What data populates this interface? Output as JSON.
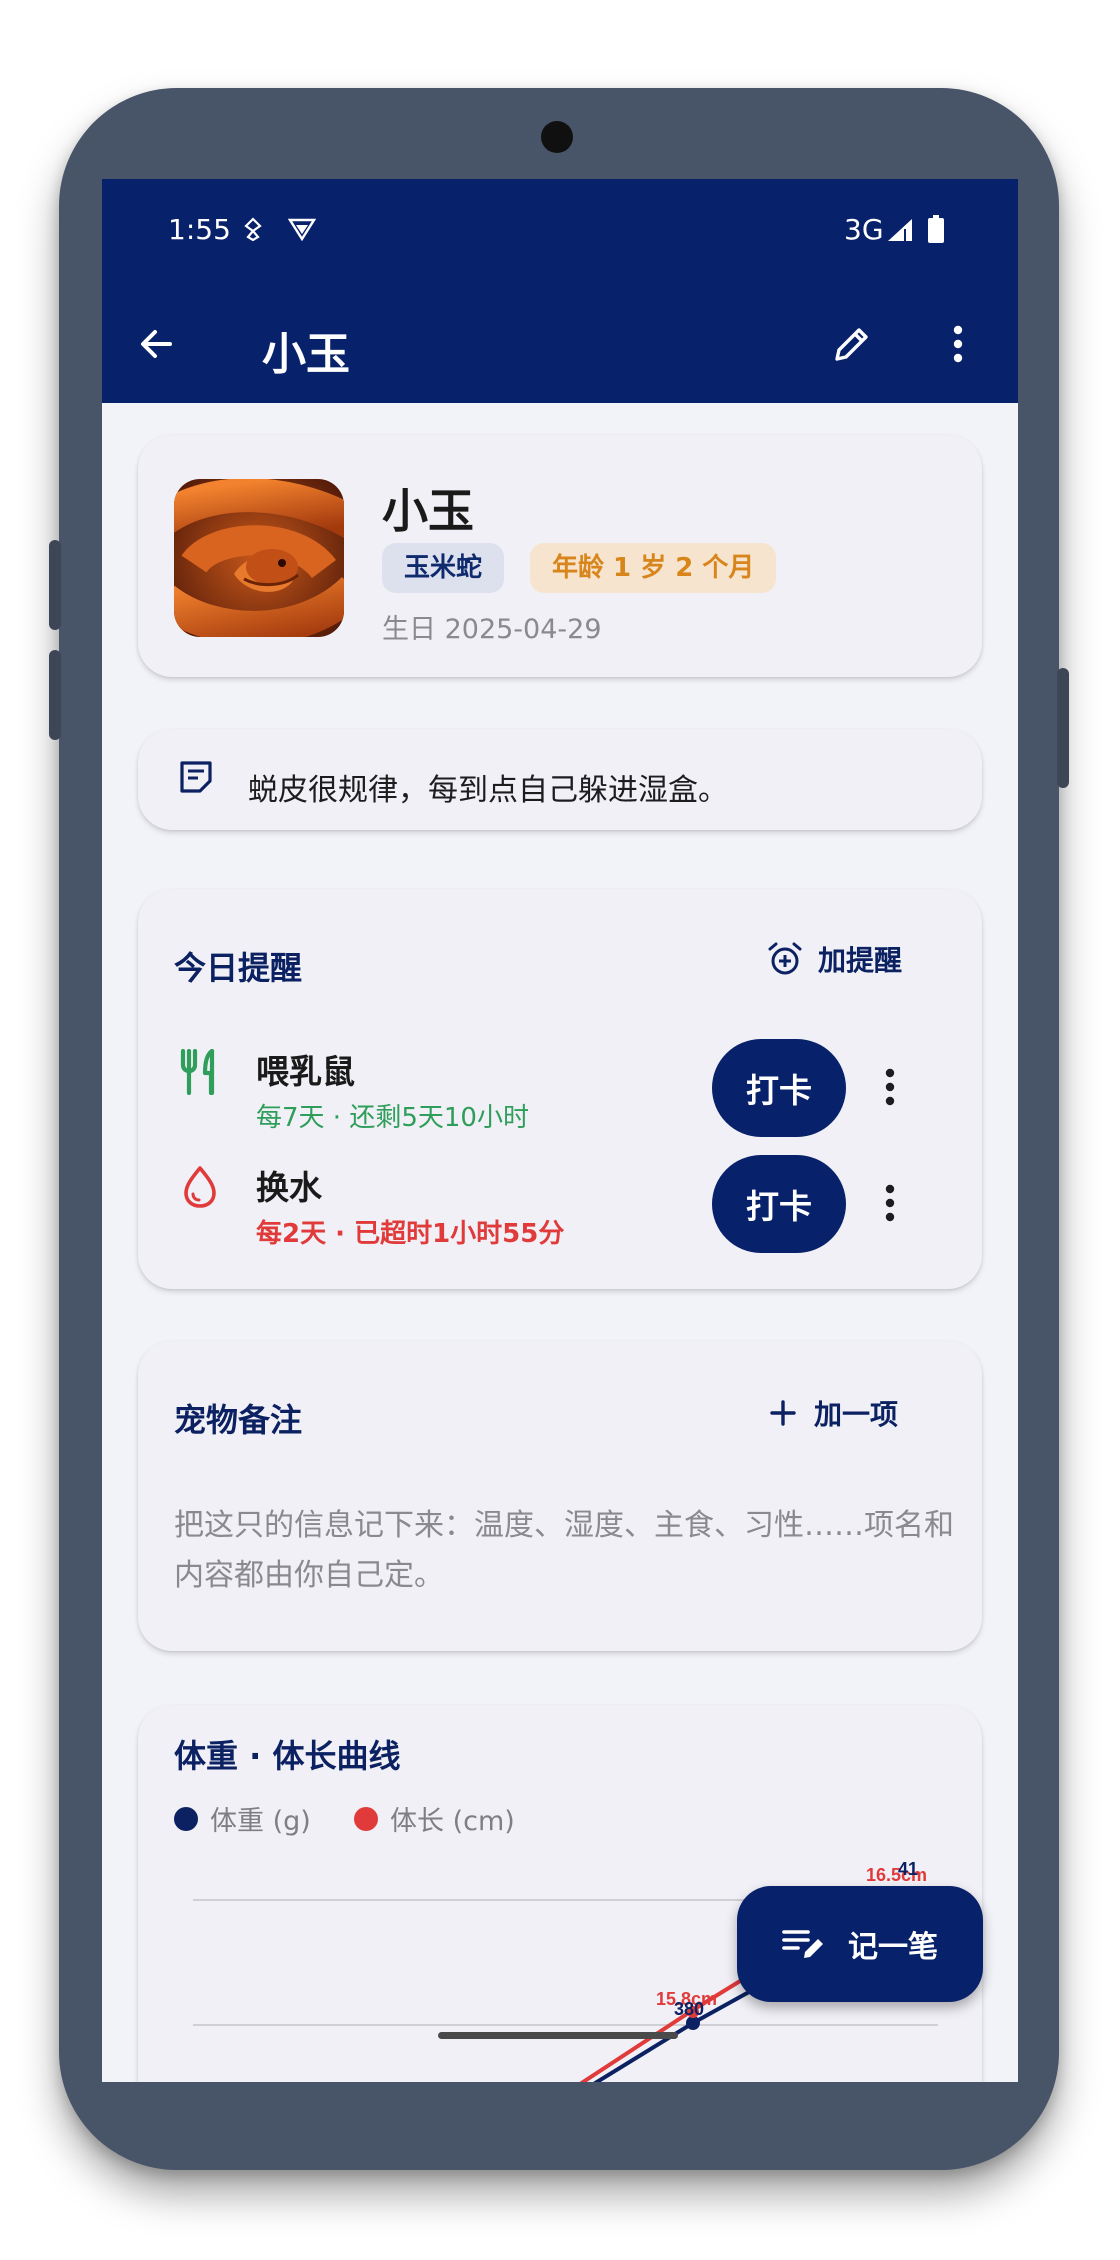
{
  "status_bar": {
    "time": "1:55",
    "network": "3G"
  },
  "app_bar": {
    "title": "小玉",
    "back_icon": "arrow-left-icon",
    "edit_icon": "pencil-icon",
    "more_icon": "more-vert-icon"
  },
  "profile": {
    "name": "小玉",
    "species": "玉米蛇",
    "age": "年龄 1 岁 2 个月",
    "birthday": "生日 2025-04-29",
    "colors": {
      "species_chip_bg": "#dde1ee",
      "age_chip_bg": "#f7e4cf",
      "age_chip_text": "#d8851b"
    }
  },
  "note": {
    "text": "蜕皮很规律，每到点自己躲进湿盒。",
    "icon": "note-icon"
  },
  "reminders": {
    "title": "今日提醒",
    "add_label": "加提醒",
    "items": [
      {
        "title": "喂乳鼠",
        "subtitle": "每7天 · 还剩5天10小时",
        "status": "ok",
        "color": "#2e9e5a",
        "icon": "fork-knife-icon",
        "button": "打卡"
      },
      {
        "title": "换水",
        "subtitle": "每2天 · 已超时1小时55分",
        "status": "overdue",
        "color": "#e03a3a",
        "icon": "water-drop-icon",
        "button": "打卡"
      }
    ]
  },
  "pet_notes": {
    "title": "宠物备注",
    "add_label": "加一项",
    "placeholder": "把这只的信息记下来：温度、湿度、主食、习性……项名和内容都由你自己定。"
  },
  "growth_chart": {
    "title": "体重 · 体长曲线",
    "legend": [
      {
        "label": "体重 (g)",
        "color": "#0b2162"
      },
      {
        "label": "体长 (cm)",
        "color": "#e03a3a"
      }
    ]
  },
  "chart_data": {
    "type": "line",
    "series": [
      {
        "name": "体重 (g)",
        "visible_labels": [
          "380",
          "41"
        ]
      },
      {
        "name": "体长 (cm)",
        "visible_labels": [
          "15.8cm",
          "16.5cm"
        ]
      }
    ]
  },
  "fab": {
    "label": "记一笔",
    "icon": "edit-note-icon"
  },
  "theme": {
    "primary": "#08216b",
    "background": "#f2f3f8",
    "card": "#f0f0f6"
  }
}
